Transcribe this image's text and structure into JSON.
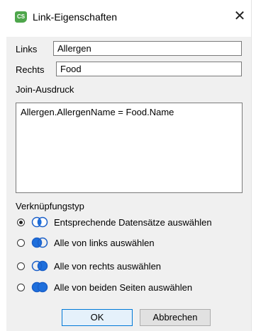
{
  "window": {
    "title": "Link-Eigenschaften",
    "app_icon_text": "CS"
  },
  "fields": {
    "links_label": "Links",
    "links_value": "Allergen",
    "rechts_label": "Rechts",
    "rechts_value": "Food",
    "join_label": "Join-Ausdruck",
    "join_expression": "Allergen.AllergenName = Food.Name"
  },
  "link_type": {
    "label": "Verknüpfungstyp",
    "selected_index": 0,
    "options": [
      {
        "label": "Entsprechende Datensätze auswählen",
        "icon": "inner-join-icon"
      },
      {
        "label": "Alle von links auswählen",
        "icon": "left-join-icon"
      },
      {
        "label": "Alle von rechts auswählen",
        "icon": "right-join-icon"
      },
      {
        "label": "Alle von beiden Seiten auswählen",
        "icon": "full-join-icon"
      }
    ]
  },
  "buttons": {
    "ok": "OK",
    "cancel": "Abbrechen"
  },
  "colors": {
    "join_fill": "#1e6fdc",
    "join_stroke": "#1a5fc8",
    "app_icon": "#4ea64b",
    "ok_border": "#0078d7"
  }
}
